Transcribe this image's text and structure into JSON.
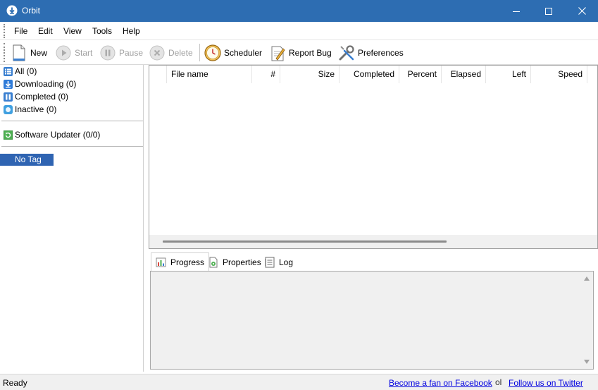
{
  "window": {
    "title": "Orbit"
  },
  "menu": {
    "items": [
      "File",
      "Edit",
      "View",
      "Tools",
      "Help"
    ]
  },
  "toolbar": {
    "new": "New",
    "start": "Start",
    "pause": "Pause",
    "delete": "Delete",
    "scheduler": "Scheduler",
    "report_bug": "Report Bug",
    "preferences": "Preferences"
  },
  "sidebar": {
    "categories": [
      {
        "label": "All (0)",
        "icon": "list-icon",
        "color": "#3a7fd0"
      },
      {
        "label": "Downloading (0)",
        "icon": "download-arrow-icon",
        "color": "#2f7bd8"
      },
      {
        "label": "Completed (0)",
        "icon": "completed-icon",
        "color": "#3a7fd0"
      },
      {
        "label": "Inactive (0)",
        "icon": "inactive-icon",
        "color": "#3fa0e0"
      }
    ],
    "software_updater": "Software Updater (0/0)",
    "tag": "No Tag (0)"
  },
  "file_list": {
    "columns": [
      "File name",
      "#",
      "Size",
      "Completed",
      "Percent",
      "Elapsed",
      "Left",
      "Speed"
    ]
  },
  "tabs": [
    "Progress",
    "Properties",
    "Log"
  ],
  "status": {
    "ready": "Ready",
    "facebook": "Become a fan on Facebook",
    "facebook_overlay": "ol",
    "twitter": "Follow us on Twitter"
  },
  "colors": {
    "titlebar": "#2d6db2",
    "selection": "#2f64b2",
    "link": "#0000e0"
  }
}
